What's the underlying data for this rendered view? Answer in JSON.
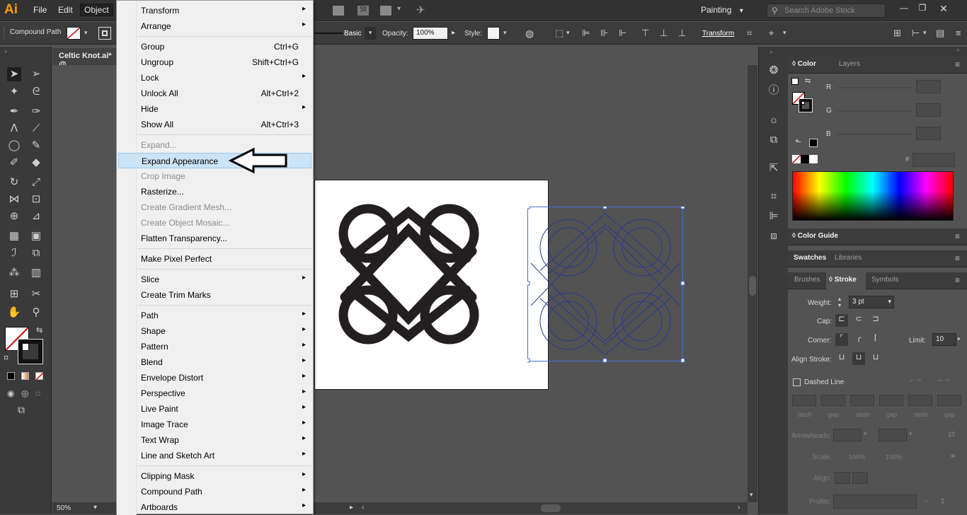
{
  "app": {
    "logo": "Ai",
    "menus": [
      "File",
      "Edit",
      "Object"
    ],
    "workspace": "Painting",
    "search_placeholder": "Search Adobe Stock"
  },
  "control_bar": {
    "selection_type": "Compound Path",
    "stroke_style": "Basic",
    "opacity_label": "Opacity:",
    "opacity_value": "100%",
    "style_label": "Style:",
    "transform_label": "Transform"
  },
  "document": {
    "tab_title": "Celtic Knot.ai* @",
    "zoom": "50%"
  },
  "object_menu": [
    {
      "label": "Transform",
      "shortcut": "",
      "submenu": true,
      "disabled": false
    },
    {
      "label": "Arrange",
      "shortcut": "",
      "submenu": true,
      "disabled": false
    },
    {
      "sep": true
    },
    {
      "label": "Group",
      "shortcut": "Ctrl+G",
      "submenu": false,
      "disabled": false
    },
    {
      "label": "Ungroup",
      "shortcut": "Shift+Ctrl+G",
      "submenu": false,
      "disabled": false
    },
    {
      "label": "Lock",
      "shortcut": "",
      "submenu": true,
      "disabled": false
    },
    {
      "label": "Unlock All",
      "shortcut": "Alt+Ctrl+2",
      "submenu": false,
      "disabled": false
    },
    {
      "label": "Hide",
      "shortcut": "",
      "submenu": true,
      "disabled": false
    },
    {
      "label": "Show All",
      "shortcut": "Alt+Ctrl+3",
      "submenu": false,
      "disabled": false
    },
    {
      "sep": true
    },
    {
      "label": "Expand...",
      "shortcut": "",
      "submenu": false,
      "disabled": true
    },
    {
      "label": "Expand Appearance",
      "shortcut": "",
      "submenu": false,
      "disabled": false,
      "highlighted": true
    },
    {
      "label": "Crop Image",
      "shortcut": "",
      "submenu": false,
      "disabled": true
    },
    {
      "label": "Rasterize...",
      "shortcut": "",
      "submenu": false,
      "disabled": false
    },
    {
      "label": "Create Gradient Mesh...",
      "shortcut": "",
      "submenu": false,
      "disabled": true
    },
    {
      "label": "Create Object Mosaic...",
      "shortcut": "",
      "submenu": false,
      "disabled": true
    },
    {
      "label": "Flatten Transparency...",
      "shortcut": "",
      "submenu": false,
      "disabled": false
    },
    {
      "sep": true
    },
    {
      "label": "Make Pixel Perfect",
      "shortcut": "",
      "submenu": false,
      "disabled": false
    },
    {
      "sep": true
    },
    {
      "label": "Slice",
      "shortcut": "",
      "submenu": true,
      "disabled": false
    },
    {
      "label": "Create Trim Marks",
      "shortcut": "",
      "submenu": false,
      "disabled": false
    },
    {
      "sep": true
    },
    {
      "label": "Path",
      "shortcut": "",
      "submenu": true,
      "disabled": false
    },
    {
      "label": "Shape",
      "shortcut": "",
      "submenu": true,
      "disabled": false
    },
    {
      "label": "Pattern",
      "shortcut": "",
      "submenu": true,
      "disabled": false
    },
    {
      "label": "Blend",
      "shortcut": "",
      "submenu": true,
      "disabled": false
    },
    {
      "label": "Envelope Distort",
      "shortcut": "",
      "submenu": true,
      "disabled": false
    },
    {
      "label": "Perspective",
      "shortcut": "",
      "submenu": true,
      "disabled": false
    },
    {
      "label": "Live Paint",
      "shortcut": "",
      "submenu": true,
      "disabled": false
    },
    {
      "label": "Image Trace",
      "shortcut": "",
      "submenu": true,
      "disabled": false
    },
    {
      "label": "Text Wrap",
      "shortcut": "",
      "submenu": true,
      "disabled": false
    },
    {
      "label": "Line and Sketch Art",
      "shortcut": "",
      "submenu": true,
      "disabled": false
    },
    {
      "sep": true
    },
    {
      "label": "Clipping Mask",
      "shortcut": "",
      "submenu": true,
      "disabled": false
    },
    {
      "label": "Compound Path",
      "shortcut": "",
      "submenu": true,
      "disabled": false
    },
    {
      "label": "Artboards",
      "shortcut": "",
      "submenu": true,
      "disabled": false
    }
  ],
  "color_panel": {
    "tabs": [
      "Color",
      "Layers"
    ],
    "channels": [
      "R",
      "G",
      "B"
    ],
    "hex_label": "#"
  },
  "color_guide": {
    "title": "Color Guide"
  },
  "swatches_group": {
    "tabs": [
      "Swatches",
      "Libraries"
    ]
  },
  "stroke_group": {
    "tabs": [
      "Brushes",
      "Stroke",
      "Symbols"
    ]
  },
  "stroke_panel": {
    "weight_label": "Weight:",
    "weight_value": "3 pt",
    "cap_label": "Cap:",
    "corner_label": "Corner:",
    "limit_label": "Limit:",
    "limit_value": "10",
    "align_label": "Align Stroke:",
    "dashed_label": "Dashed Line",
    "dash_labels": [
      "dash",
      "gap",
      "dash",
      "gap",
      "dash",
      "gap"
    ],
    "arrowheads_label": "Arrowheads:",
    "scale_label": "Scale:",
    "scale_values": [
      "100%",
      "100%"
    ],
    "align_arrow_label": "Align:",
    "profile_label": "Profile:"
  },
  "colors": {
    "ui_dark": "#323232",
    "ui_mid": "#535353",
    "menu_bg": "#f0f0f0",
    "menu_highlight": "#cce4f7",
    "selection_blue": "#4a6bd8",
    "logo": "#ff9a00"
  }
}
